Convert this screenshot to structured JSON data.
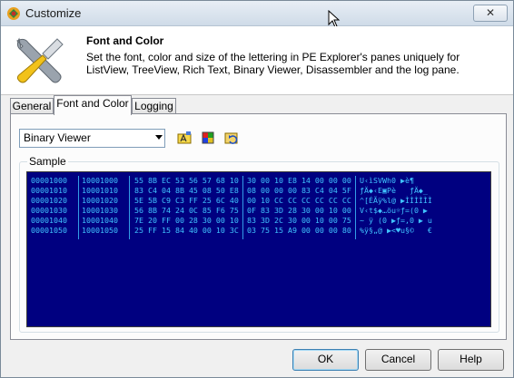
{
  "window": {
    "title": "Customize",
    "close_label": "✕"
  },
  "header": {
    "title": "Font and Color",
    "description": "Set the font, color and size of the lettering in PE Explorer's panes uniquely for ListView, TreeView, Rich Text, Binary Viewer, Disassembler and the log pane."
  },
  "tabs": [
    {
      "label": "General"
    },
    {
      "label": "Font and Color"
    },
    {
      "label": "Logging"
    }
  ],
  "pane_select": {
    "value": "Binary Viewer"
  },
  "toolbar": {
    "icons": [
      "font-icon",
      "color-palette-icon",
      "reset-icon"
    ]
  },
  "sample": {
    "label": "Sample",
    "rows": [
      {
        "a1": "00001000",
        "a2": "10001000",
        "h1": "55 8B EC 53 56 57 68 10",
        "h2": "30 00 10 E8 14 00 00 00",
        "asc": "U‹ìSVWh0 ▶è¶"
      },
      {
        "a1": "00001010",
        "a2": "10001010",
        "h1": "83 C4 04 8B 45 08 50 E8",
        "h2": "08 00 00 00 83 C4 04 5F",
        "asc": "ƒÄ◆‹E▣Pè   ƒÄ◆_"
      },
      {
        "a1": "00001020",
        "a2": "10001020",
        "h1": "5E 5B C9 C3 FF 25 6C 40",
        "h2": "00 10 CC CC CC CC CC CC",
        "asc": "^[ÉÃÿ%l@ ▶ÌÌÌÌÌÌ"
      },
      {
        "a1": "00001030",
        "a2": "10001030",
        "h1": "56 8B 74 24 0C 85 F6 75",
        "h2": "0F 83 3D 28 30 00 10 00",
        "asc": "V‹t$◆…öu☼ƒ=(0 ▶"
      },
      {
        "a1": "00001040",
        "a2": "10001040",
        "h1": "7E 20 FF 00 28 30 00 10",
        "h2": "83 3D 2C 30 00 10 00 75",
        "asc": "~ ÿ (0 ▶ƒ=,0 ▶ u"
      },
      {
        "a1": "00001050",
        "a2": "10001050",
        "h1": "25 FF 15 84 40 00 10 3C",
        "h2": "03 75 15 A9 00 00 00 80",
        "asc": "%ÿ§„@ ▶<♥u§©   €"
      }
    ]
  },
  "buttons": {
    "ok": "OK",
    "cancel": "Cancel",
    "help": "Help"
  }
}
